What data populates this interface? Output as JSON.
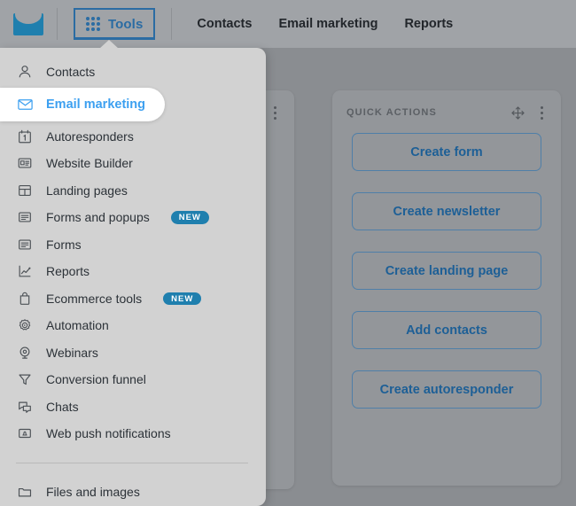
{
  "topbar": {
    "logo_icon": "envelope-logo-icon",
    "tools_button": {
      "label": "Tools",
      "icon": "grid-dots-icon",
      "active": true
    },
    "nav_links": [
      {
        "label": "Contacts"
      },
      {
        "label": "Email marketing"
      },
      {
        "label": "Reports"
      }
    ]
  },
  "menu": {
    "items": [
      {
        "label": "Contacts",
        "icon": "user-icon",
        "badge": "",
        "active": false
      },
      {
        "label": "Email marketing",
        "icon": "envelope-icon",
        "badge": "",
        "active": true
      },
      {
        "label": "Autoresponders",
        "icon": "calendar-one-icon",
        "badge": "",
        "active": false
      },
      {
        "label": "Website Builder",
        "icon": "webpage-icon",
        "badge": "",
        "active": false
      },
      {
        "label": "Landing pages",
        "icon": "layout-icon",
        "badge": "",
        "active": false
      },
      {
        "label": "Forms and popups",
        "icon": "form-lines-icon",
        "badge": "NEW",
        "active": false
      },
      {
        "label": "Forms",
        "icon": "form-lines-icon",
        "badge": "",
        "active": false
      },
      {
        "label": "Reports",
        "icon": "chart-line-icon",
        "badge": "",
        "active": false
      },
      {
        "label": "Ecommerce tools",
        "icon": "shopping-bag-icon",
        "badge": "NEW",
        "active": false
      },
      {
        "label": "Automation",
        "icon": "gear-play-icon",
        "badge": "",
        "active": false
      },
      {
        "label": "Webinars",
        "icon": "webcam-icon",
        "badge": "",
        "active": false
      },
      {
        "label": "Conversion funnel",
        "icon": "funnel-icon",
        "badge": "",
        "active": false
      },
      {
        "label": "Chats",
        "icon": "chat-bubbles-icon",
        "badge": "",
        "active": false
      },
      {
        "label": "Web push notifications",
        "icon": "bell-box-icon",
        "badge": "",
        "active": false
      }
    ],
    "footer_items": [
      {
        "label": "Files and images",
        "icon": "folder-icon",
        "badge": "",
        "active": false
      }
    ]
  },
  "cards": {
    "left": {
      "title": "",
      "move_icon": "move-handle-icon",
      "kebab_icon": "kebab-menu-icon"
    },
    "quick_actions": {
      "title": "QUICK ACTIONS",
      "move_icon": "move-handle-icon",
      "kebab_icon": "kebab-menu-icon",
      "buttons": [
        {
          "label": "Create form"
        },
        {
          "label": "Create newsletter"
        },
        {
          "label": "Create landing page"
        },
        {
          "label": "Add contacts"
        },
        {
          "label": "Create autoresponder"
        }
      ]
    }
  },
  "colors": {
    "brand_blue": "#1f7fae",
    "accent_blue": "#2b6ca3",
    "active_item_blue": "#3da0f0",
    "button_blue": "#1d5f96",
    "overlay_gray": "#8a8d91",
    "menu_bg": "#d2d2d2"
  }
}
